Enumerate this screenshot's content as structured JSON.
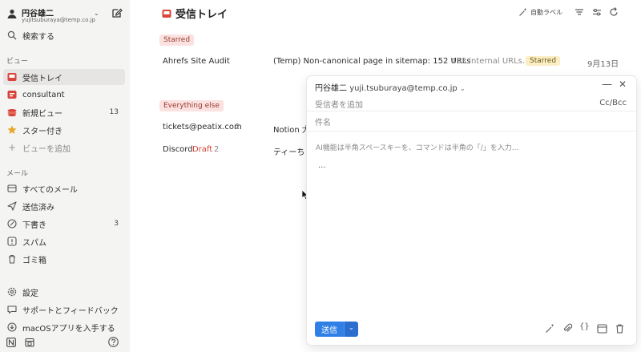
{
  "account": {
    "name": "円谷雄二",
    "email": "yujitsuburaya@temp.co.jp"
  },
  "sidebar": {
    "search_label": "検索する",
    "views_heading": "ビュー",
    "views": [
      {
        "label": "受信トレイ",
        "count": ""
      },
      {
        "label": "consultant",
        "count": ""
      },
      {
        "label": "新規ビュー",
        "count": "13"
      },
      {
        "label": "スター付き",
        "count": ""
      },
      {
        "label": "ビューを追加",
        "count": ""
      }
    ],
    "mail_heading": "メール",
    "mail": [
      {
        "label": "すべてのメール",
        "count": ""
      },
      {
        "label": "送信済み",
        "count": ""
      },
      {
        "label": "下書き",
        "count": "3"
      },
      {
        "label": "スパム",
        "count": ""
      },
      {
        "label": "ゴミ箱",
        "count": ""
      }
    ],
    "footer": [
      {
        "label": "設定"
      },
      {
        "label": "サポートとフィードバック"
      },
      {
        "label": "macOSアプリを入手する"
      }
    ]
  },
  "header": {
    "title": "受信トレイ",
    "auto_label": "自動ラベル"
  },
  "sections": {
    "starred": "Starred",
    "everything_else": "Everything else"
  },
  "rows": {
    "starred": {
      "sender": "Ahrefs Site Audit",
      "subject": "(Temp) Non-canonical page in sitemap: 152 URLs",
      "preview": "433 internal URLs...",
      "tag": "Starred",
      "date": "9月13日"
    },
    "other": [
      {
        "sender": "tickets@peatix.com",
        "draft": "",
        "count": "2",
        "subject": "Notion 大"
      },
      {
        "sender": "Discord",
        "draft": "Draft",
        "count": "2",
        "subject": "ティーち"
      }
    ]
  },
  "compose": {
    "from_name": "円谷雄二",
    "from_email": "yuji.tsuburaya@temp.co.jp",
    "to_placeholder": "受信者を追加",
    "cc_bcc": "Cc/Bcc",
    "subject_placeholder": "件名",
    "body_placeholder": "AI機能は半角スペースキーを、コマンドは半角の「/」を入力...",
    "dots": "...",
    "send_label": "送信"
  },
  "colors": {
    "accent_red": "#d9443a",
    "send_blue": "#2f7fe6",
    "draft_red": "#d9443a",
    "star_yellow": "#e8a92a"
  }
}
